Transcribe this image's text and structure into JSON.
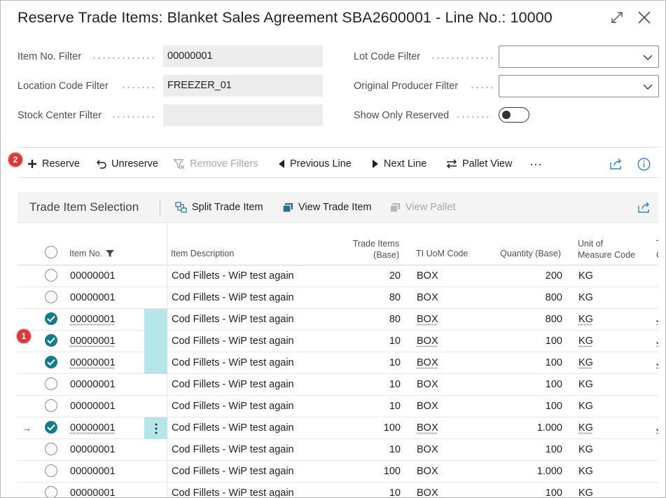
{
  "window": {
    "title": "Reserve Trade Items: Blanket Sales Agreement SBA2600001 - Line No.: 10000",
    "expand_icon": "expand-icon",
    "close_icon": "close-icon"
  },
  "filters": {
    "item_no": {
      "label": "Item No. Filter",
      "value": "00000001"
    },
    "location_code": {
      "label": "Location Code Filter",
      "value": "FREEZER_01"
    },
    "stock_center": {
      "label": "Stock Center Filter",
      "value": ""
    },
    "lot_code": {
      "label": "Lot Code Filter",
      "value": ""
    },
    "original_producer": {
      "label": "Original Producer Filter",
      "value": ""
    },
    "show_only_reserved": {
      "label": "Show Only Reserved",
      "value": false
    }
  },
  "actions": {
    "reserve": "Reserve",
    "unreserve": "Unreserve",
    "remove_filters": "Remove Filters",
    "previous_line": "Previous Line",
    "next_line": "Next Line",
    "pallet_view": "Pallet View",
    "more": "···"
  },
  "badges": {
    "reserve_step": "2",
    "selected_rows_step": "1"
  },
  "part": {
    "title": "Trade Item Selection",
    "split_trade_item": "Split Trade Item",
    "view_trade_item": "View Trade Item",
    "view_pallet": "View Pallet"
  },
  "columns": {
    "item_no": "Item No.",
    "item_description": "Item Description",
    "trade_items_1": "Trade Items",
    "trade_items_2": "(Base)",
    "ti_uom_code": "TI UoM Code",
    "quantity_base": "Quantity (Base)",
    "uom_1": "Unit of",
    "uom_2": "Measure Code",
    "next_col_1": "T",
    "next_col_2": "C"
  },
  "rows": [
    {
      "selected": false,
      "item_no": "00000001",
      "description": "Cod Fillets - WiP test again",
      "trade_items": "20",
      "ti_uom": "BOX",
      "quantity": "200",
      "uom": "KG",
      "next": ""
    },
    {
      "selected": false,
      "item_no": "00000001",
      "description": "Cod Fillets - WiP test again",
      "trade_items": "80",
      "ti_uom": "BOX",
      "quantity": "800",
      "uom": "KG",
      "next": ""
    },
    {
      "selected": true,
      "item_no": "00000001",
      "description": "Cod Fillets - WiP test again",
      "trade_items": "80",
      "ti_uom": "BOX",
      "quantity": "800",
      "uom": "KG",
      "next": "J"
    },
    {
      "selected": true,
      "item_no": "00000001",
      "description": "Cod Fillets - WiP test again",
      "trade_items": "10",
      "ti_uom": "BOX",
      "quantity": "100",
      "uom": "KG",
      "next": "J"
    },
    {
      "selected": true,
      "item_no": "00000001",
      "description": "Cod Fillets - WiP test again",
      "trade_items": "10",
      "ti_uom": "BOX",
      "quantity": "100",
      "uom": "KG",
      "next": "J"
    },
    {
      "selected": false,
      "item_no": "00000001",
      "description": "Cod Fillets - WiP test again",
      "trade_items": "10",
      "ti_uom": "BOX",
      "quantity": "100",
      "uom": "KG",
      "next": ""
    },
    {
      "selected": false,
      "item_no": "00000001",
      "description": "Cod Fillets - WiP test again",
      "trade_items": "10",
      "ti_uom": "BOX",
      "quantity": "100",
      "uom": "KG",
      "next": ""
    },
    {
      "selected": true,
      "current": true,
      "item_no": "00000001",
      "description": "Cod Fillets - WiP test again",
      "trade_items": "100",
      "ti_uom": "BOX",
      "quantity": "1.000",
      "uom": "KG",
      "next": "J"
    },
    {
      "selected": false,
      "item_no": "00000001",
      "description": "Cod Fillets - WiP test again",
      "trade_items": "10",
      "ti_uom": "BOX",
      "quantity": "100",
      "uom": "KG",
      "next": ""
    },
    {
      "selected": false,
      "item_no": "00000001",
      "description": "Cod Fillets - WiP test again",
      "trade_items": "100",
      "ti_uom": "BOX",
      "quantity": "1.000",
      "uom": "KG",
      "next": ""
    },
    {
      "selected": false,
      "item_no": "00000001",
      "description": "Cod Fillets - WiP test again",
      "trade_items": "10",
      "ti_uom": "BOX",
      "quantity": "100",
      "uom": "KG",
      "next": ""
    }
  ],
  "colors": {
    "accent": "#137b8a",
    "row_highlight": "#b5e6ea",
    "badge": "#d83b3b"
  }
}
